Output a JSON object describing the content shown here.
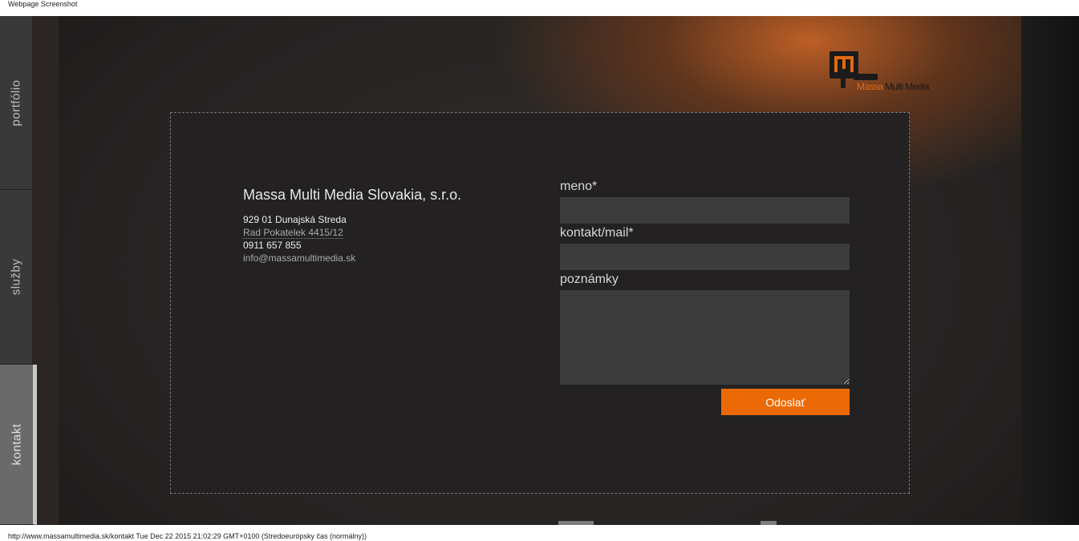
{
  "screenshot": {
    "header_label": "Webpage Screenshot",
    "footer_label": "http://www.massamultimedia.sk/kontakt Tue Dec 22 2015 21:02:29 GMT+0100 (Stredoeurópsky čas (normálny))"
  },
  "sidebar": {
    "items": [
      {
        "label": "portfólio"
      },
      {
        "label": "služby"
      },
      {
        "label": "kontakt"
      }
    ]
  },
  "logo": {
    "first_word": "Massa",
    "rest": " Multi Media"
  },
  "contact": {
    "company_name": "Massa Multi Media Slovakia, s.r.o.",
    "city": "929 01 Dunajská Streda",
    "street": "Rad Pokatelek 4415/12",
    "phone": "0911 657 855",
    "email": "info@massamultimedia.sk"
  },
  "form": {
    "name_label": "meno*",
    "name_value": "",
    "contact_label": "kontakt/mail*",
    "contact_value": "",
    "notes_label": "poznámky",
    "notes_value": "",
    "submit_label": "Odoslať"
  },
  "colors": {
    "accent": "#ec6a06",
    "card_bg": "#232122",
    "field_bg": "#3d3c3c"
  }
}
